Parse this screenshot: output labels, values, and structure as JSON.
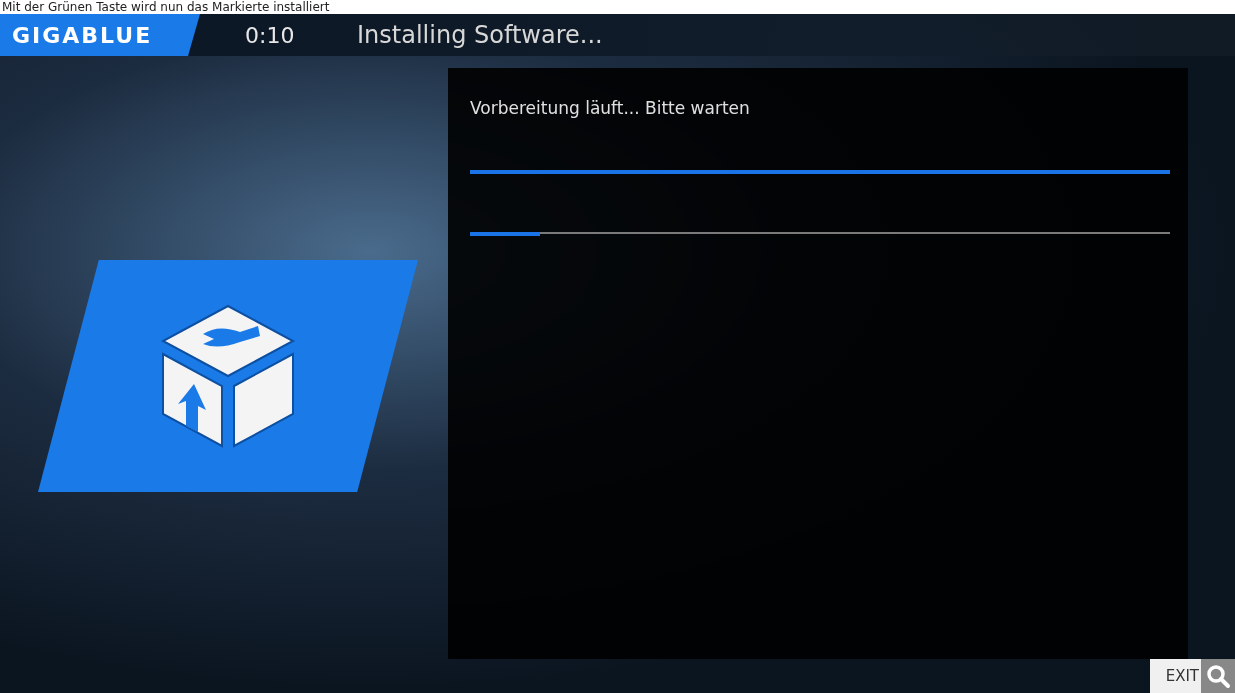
{
  "caption": "Mit der Grünen Taste wird nun das Markierte installiert",
  "header": {
    "logo": "GIGABLUE",
    "time": "0:10",
    "title": "Installing Software..."
  },
  "panel": {
    "status": "Vorbereitung läuft... Bitte warten",
    "progress_bars": [
      {
        "level": 1.0
      },
      {
        "level": 0.1
      }
    ]
  },
  "exit_button": {
    "label": "EXIT"
  }
}
